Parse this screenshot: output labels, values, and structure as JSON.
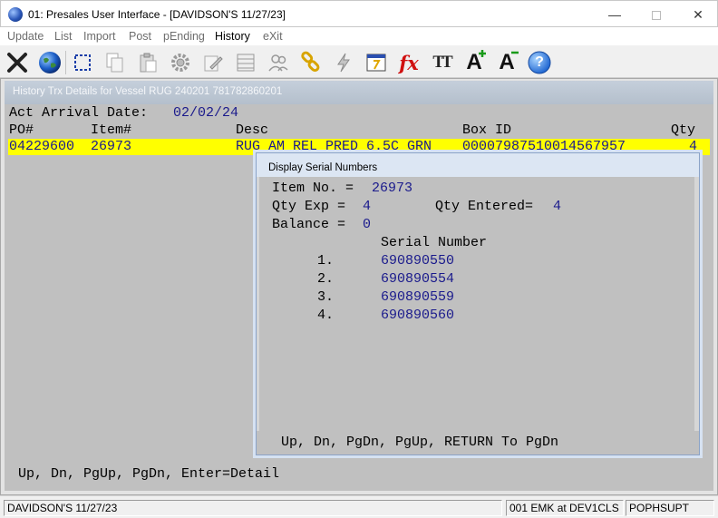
{
  "window": {
    "title": "01: Presales User Interface - [DAVIDSON'S 11/27/23]",
    "min_glyph": "—",
    "close_glyph": "✕"
  },
  "menu": [
    {
      "label": "Update",
      "active": false
    },
    {
      "label": "List",
      "active": false
    },
    {
      "label": "Import",
      "active": false
    },
    {
      "label": "Post",
      "active": false
    },
    {
      "label": "pEnding",
      "active": false
    },
    {
      "label": "History",
      "active": true
    },
    {
      "label": "eXit",
      "active": false
    }
  ],
  "toolbar": {
    "icons": [
      "exit-x-icon",
      "globe-icon",
      "select-rectangle-icon",
      "copy-icon",
      "paste-icon",
      "settings-gear-icon",
      "edit-pencil-icon",
      "list-grid-icon",
      "users-icon",
      "link-chain-icon",
      "lightning-icon",
      "calculator-display-icon",
      "function-fx-icon",
      "text-size-icon",
      "increase-font-icon",
      "decrease-font-icon",
      "help-icon"
    ],
    "fx_text": "fx",
    "tt_text": "TT",
    "a_text": "A",
    "help_text": "?"
  },
  "inner_window": {
    "title": "History Trx Details for Vessel   RUG 240201 781782860201"
  },
  "console": {
    "arrival_label": "Act Arrival Date:",
    "arrival_date": "02/02/24",
    "headers": {
      "po": "PO#",
      "item": "Item#",
      "desc": "Desc",
      "box": "Box ID",
      "qty": "Qty"
    },
    "row": {
      "po": "04229600",
      "item": "26973",
      "desc": "RUG AM REL PRED 6.5C GRN",
      "box": "00007987510014567957",
      "qty": "4"
    },
    "footer": "Up, Dn, PgUp, PgDn, Enter=Detail"
  },
  "dialog": {
    "title": "Display Serial Numbers",
    "item_label": "Item No. =",
    "item_value": "26973",
    "qty_exp_label": "Qty Exp =",
    "qty_exp_value": "4",
    "qty_entered_label": "Qty Entered=",
    "qty_entered_value": "4",
    "balance_label": "Balance =",
    "balance_value": "0",
    "serial_header": "Serial Number",
    "serials": [
      {
        "n": "1.",
        "value": "690890550"
      },
      {
        "n": "2.",
        "value": "690890554"
      },
      {
        "n": "3.",
        "value": "690890559"
      },
      {
        "n": "4.",
        "value": "690890560"
      }
    ],
    "footer": "Up, Dn, PgDn, PgUp, RETURN To PgDn"
  },
  "status": {
    "left": "DAVIDSON'S 11/27/23",
    "mid": "001 EMK at DEV1CLS",
    "right": "POPHSUPT"
  }
}
